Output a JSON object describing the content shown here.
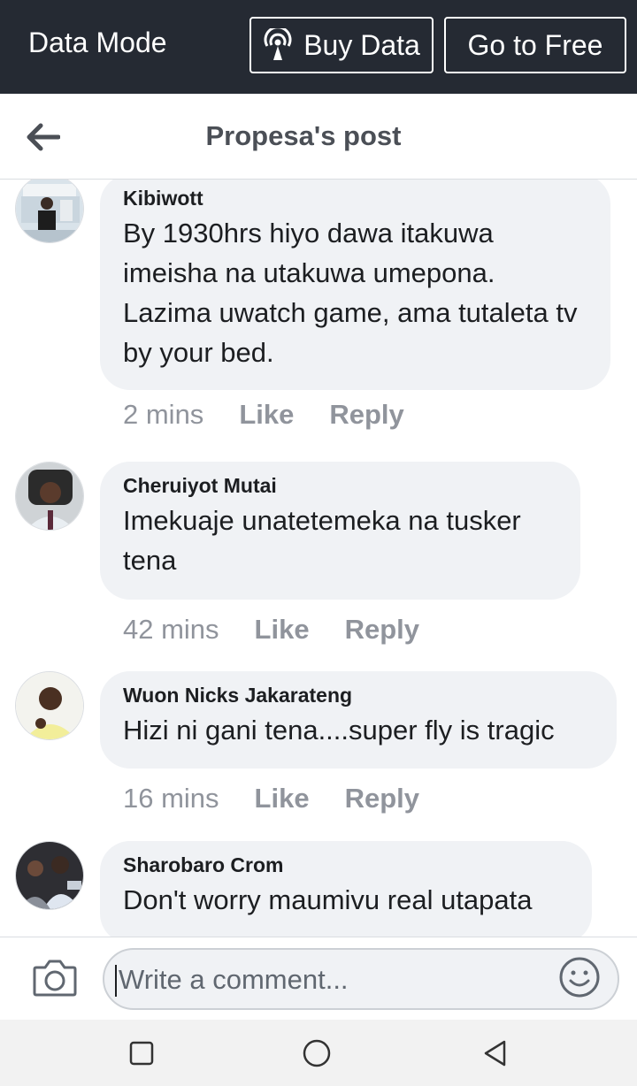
{
  "databar": {
    "mode_label": "Data Mode",
    "buy_data_label": "Buy Data",
    "go_free_label": "Go to Free"
  },
  "header": {
    "title": "Propesa's post"
  },
  "comments": [
    {
      "author": "Kibiwott",
      "text": "By 1930hrs hiyo dawa itakuwa imeisha na utakuwa umepona. Lazima uwatch game, ama tutaleta tv by your bed.",
      "time": "2 mins",
      "like": "Like",
      "reply": "Reply"
    },
    {
      "author": "Cheruiyot Mutai",
      "text": "Imekuaje unatetemeka na tusker tena",
      "time": "42 mins",
      "like": "Like",
      "reply": "Reply"
    },
    {
      "author": "Wuon Nicks Jakarateng",
      "text": "Hizi ni gani tena....super fly is tragic",
      "time": "16 mins",
      "like": "Like",
      "reply": "Reply"
    },
    {
      "author": "Sharobaro Crom",
      "text": "Don't worry maumivu real utapata",
      "time": "",
      "like": "",
      "reply": ""
    }
  ],
  "composer": {
    "placeholder": "Write a comment..."
  },
  "icons": {
    "back": "arrow-left-icon",
    "buy": "broadcast-icon",
    "camera": "camera-icon",
    "emoji": "smiley-icon",
    "nav": [
      "square-icon",
      "circle-icon",
      "triangle-back-icon"
    ]
  }
}
